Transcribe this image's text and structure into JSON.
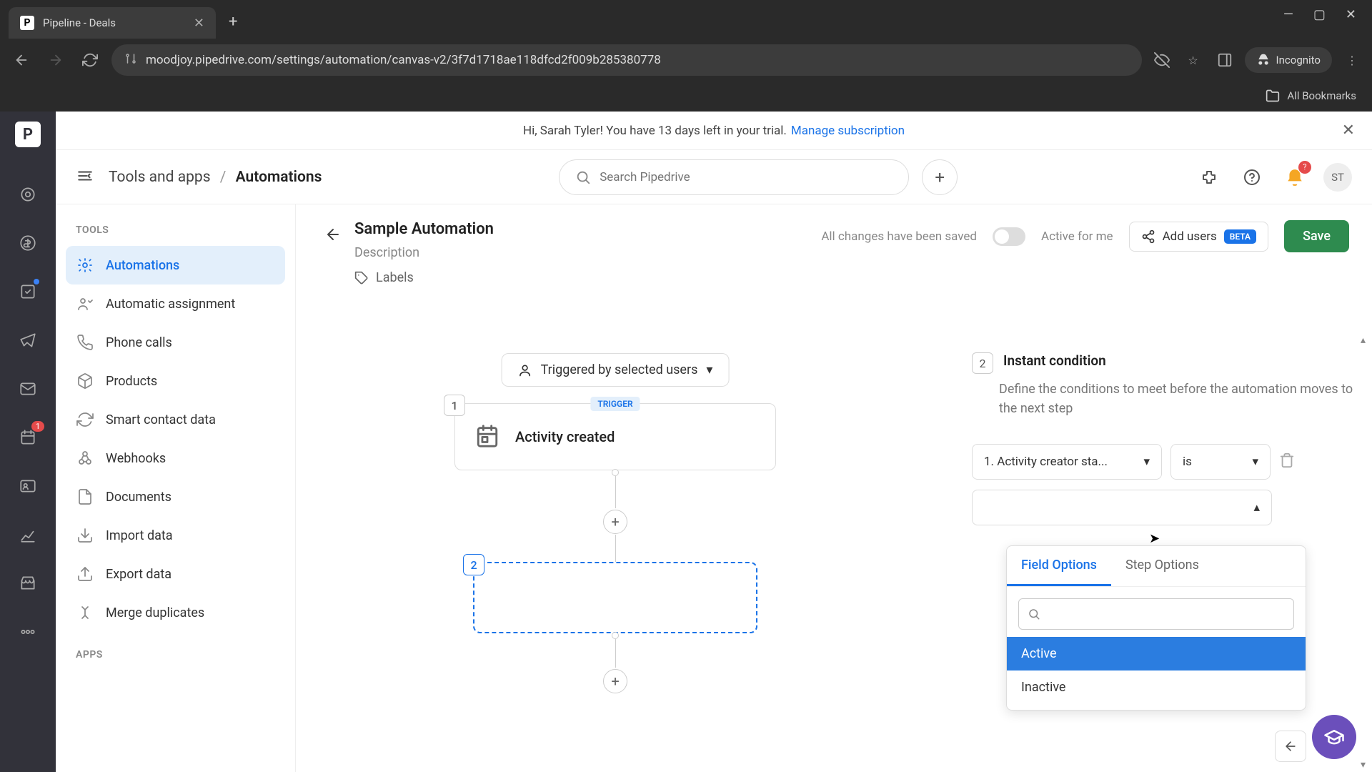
{
  "browser": {
    "tab_title": "Pipeline - Deals",
    "url": "moodjoy.pipedrive.com/settings/automation/canvas-v2/3f7d1718ae118dfcd2f009b285380778",
    "incognito_label": "Incognito",
    "bookmarks_label": "All Bookmarks"
  },
  "trial_banner": {
    "message": "Hi, Sarah Tyler! You have 13 days left in your trial.",
    "link": "Manage subscription"
  },
  "header": {
    "breadcrumb_root": "Tools and apps",
    "breadcrumb_current": "Automations",
    "search_placeholder": "Search Pipedrive",
    "avatar_initials": "ST",
    "notification_count": "?"
  },
  "sidebar": {
    "section_tools": "TOOLS",
    "section_apps": "APPS",
    "items": [
      {
        "label": "Automations"
      },
      {
        "label": "Automatic assignment"
      },
      {
        "label": "Phone calls"
      },
      {
        "label": "Products"
      },
      {
        "label": "Smart contact data"
      },
      {
        "label": "Webhooks"
      },
      {
        "label": "Documents"
      },
      {
        "label": "Import data"
      },
      {
        "label": "Export data"
      },
      {
        "label": "Merge duplicates"
      }
    ]
  },
  "automation": {
    "title": "Sample Automation",
    "description_placeholder": "Description",
    "labels_placeholder": "Labels",
    "saved_text": "All changes have been saved",
    "toggle_label": "Active for me",
    "add_users_label": "Add users",
    "beta_label": "BETA",
    "save_label": "Save"
  },
  "canvas": {
    "trigger_pill": "Triggered by selected users",
    "step1_num": "1",
    "step1_badge": "TRIGGER",
    "step1_title": "Activity created",
    "step2_num": "2"
  },
  "panel": {
    "num": "2",
    "title": "Instant condition",
    "description": "Define the conditions to meet before the automation moves to the next step",
    "field_label": "1. Activity creator sta...",
    "operator_label": "is",
    "value_label": ""
  },
  "dropdown": {
    "tab_field": "Field Options",
    "tab_step": "Step Options",
    "options": [
      {
        "label": "Active"
      },
      {
        "label": "Inactive"
      }
    ]
  },
  "rail_badges": {
    "projects": "1"
  }
}
